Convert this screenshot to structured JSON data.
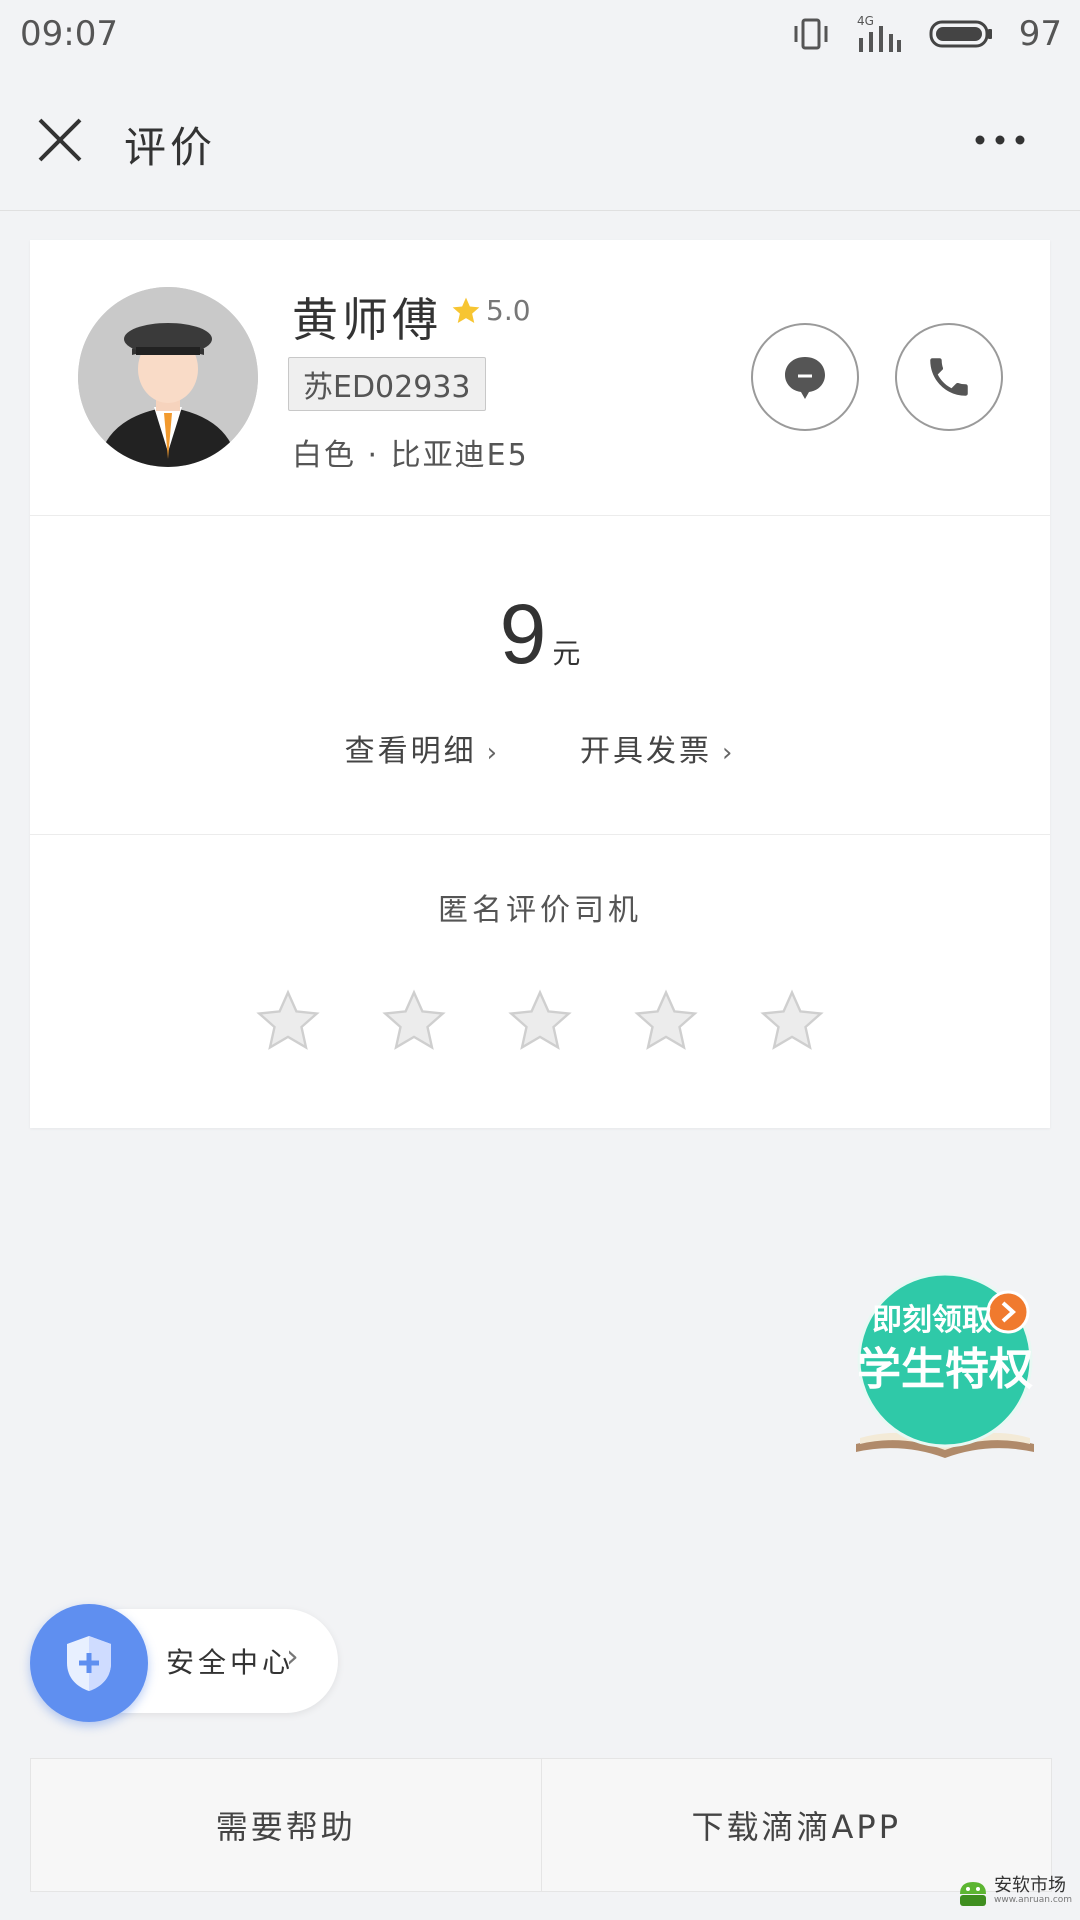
{
  "status_bar": {
    "time": "09:07",
    "battery": "97",
    "network": "4G"
  },
  "nav": {
    "title": "评价"
  },
  "driver": {
    "name": "黄师傅",
    "rating": "5.0",
    "plate": "苏ED02933",
    "car": "白色 · 比亚迪E5"
  },
  "fare": {
    "amount": "9",
    "unit": "元",
    "details_link": "查看明细",
    "invoice_link": "开具发票"
  },
  "rating_section": {
    "title": "匿名评价司机",
    "stars": 5,
    "selected": 0
  },
  "promo": {
    "line1": "即刻领取",
    "line2": "学生特权"
  },
  "safety": {
    "label": "安全中心"
  },
  "bottom": {
    "help": "需要帮助",
    "download": "下载滴滴APP"
  },
  "watermark": {
    "name": "安软市场",
    "url": "www.anruan.com"
  },
  "colors": {
    "accent_blue": "#5f8ff0",
    "star_yellow": "#f7c531",
    "promo_green": "#2fc9a8",
    "promo_orange": "#f07a2e"
  }
}
